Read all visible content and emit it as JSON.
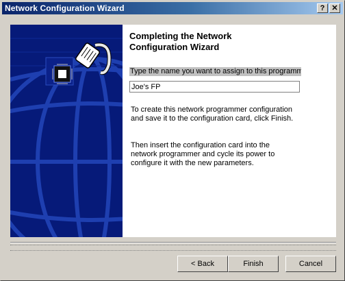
{
  "window": {
    "title": "Network Configuration Wizard",
    "help_glyph": "?",
    "close_glyph": "✕"
  },
  "main": {
    "heading_line1": "Completing the Network",
    "heading_line2": "Configuration Wizard",
    "prompt": "Type the name you want to assign to this programmer",
    "name_value": "Joe's FP",
    "para1_line1": "To create this network programmer configuration",
    "para1_line2": "and save it to the configuration card, click Finish.",
    "para2_line1": "Then insert the configuration card into the",
    "para2_line2": "network programmer and cycle its power to",
    "para2_line3": "configure it with the new parameters."
  },
  "buttons": {
    "back": "< Back",
    "finish": "Finish",
    "cancel": "Cancel"
  },
  "colors": {
    "title_start": "#0a246a",
    "title_end": "#a6caf0",
    "side_panel": "#061a79",
    "globe_lines": "#1e3fb0",
    "chrome": "#d4d0c8"
  },
  "icons": {
    "side_image": "network-cable-globe-icon"
  }
}
